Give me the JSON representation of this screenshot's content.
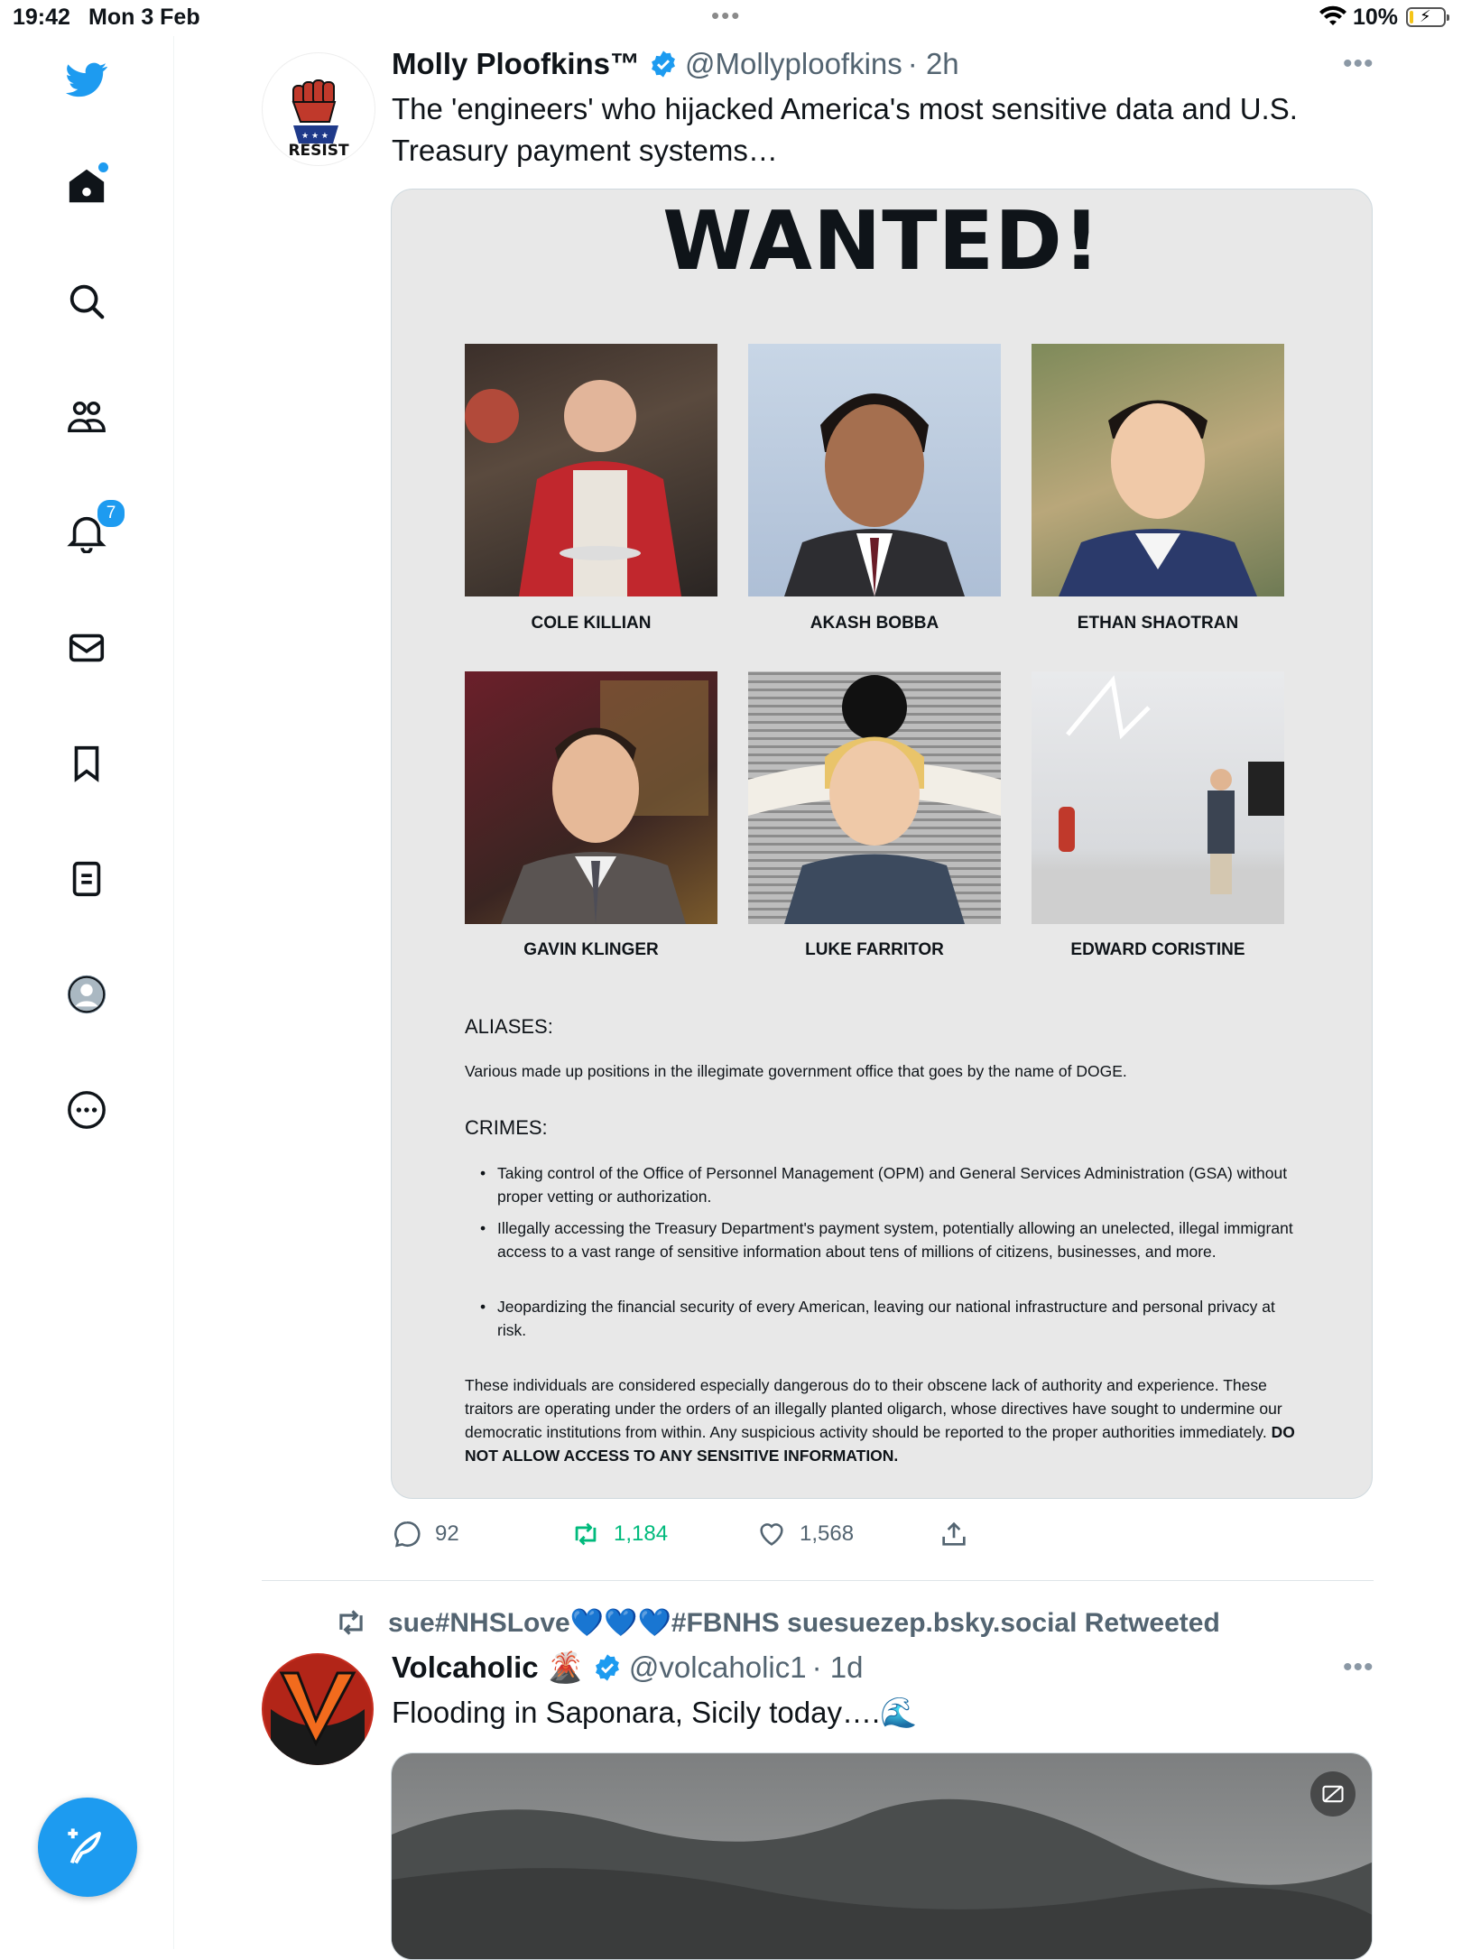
{
  "status_bar": {
    "time": "19:42",
    "date": "Mon 3 Feb",
    "battery": "10%",
    "battery_level": 0.1
  },
  "sidebar": {
    "notifications_badge": "7"
  },
  "tweet1": {
    "name": "Molly Ploofkins™",
    "handle": "@Mollyploofkins",
    "time": "· 2h",
    "text": "The 'engineers' who hijacked America's most sensitive data and U.S. Treasury payment systems…",
    "avatar_label": "RESIST",
    "poster": {
      "title": "WANTED!",
      "people": [
        "COLE KILLIAN",
        "AKASH BOBBA",
        "ETHAN SHAOTRAN",
        "GAVIN KLINGER",
        "LUKE FARRITOR",
        "EDWARD CORISTINE"
      ],
      "aliases_heading": "ALIASES:",
      "aliases_text": "Various made up positions in the illegimate government office that goes by the name of DOGE.",
      "crimes_heading": "CRIMES:",
      "crimes": [
        "Taking control of the Office of Personnel Management (OPM) and General Services Administration (GSA) without proper vetting or authorization.",
        "Illegally accessing the Treasury Department's payment system, potentially allowing an unelected, illegal immigrant access to a vast range of sensitive information about tens of millions of citizens, businesses, and more.",
        "Jeopardizing the financial security of every American, leaving our national infrastructure and personal privacy at risk."
      ],
      "warning_text": "These individuals are considered especially dangerous do to their obscene lack of authority and experience. These traitors are operating under the orders of an illegally planted oligarch, whose directives have sought to undermine our democratic institutions from within. Any suspicious activity should be reported to the proper authorities immediately.",
      "warning_bold": "DO NOT ALLOW ACCESS TO ANY SENSITIVE INFORMATION."
    },
    "replies": "92",
    "retweets": "1,184",
    "likes": "1,568"
  },
  "retweet_banner": "sue#NHSLove💙💙💙#FBNHS suesuezep.bsky.social Retweeted",
  "tweet2": {
    "name": "Volcaholic 🌋",
    "handle": "@volcaholic1",
    "time": "· 1d",
    "text": "Flooding in Saponara, Sicily today….🌊",
    "avatar_letter": "V"
  },
  "colors": {
    "accent": "#1d9bf0",
    "retweet_green": "#00ba7c",
    "muted": "#536471"
  }
}
